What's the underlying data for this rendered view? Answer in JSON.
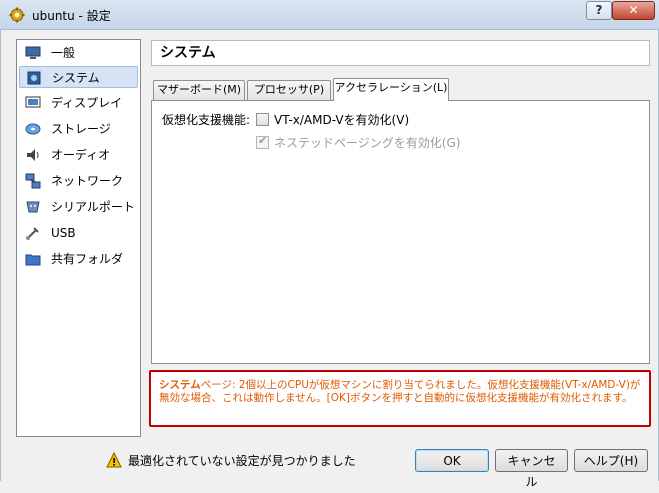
{
  "window": {
    "title": "ubuntu - 設定",
    "help_button": "?",
    "close_button": "✕"
  },
  "sidebar": {
    "items": [
      {
        "label": "一般",
        "icon": "monitor-icon"
      },
      {
        "label": "システム",
        "icon": "chip-icon"
      },
      {
        "label": "ディスプレイ",
        "icon": "display-icon"
      },
      {
        "label": "ストレージ",
        "icon": "disk-icon"
      },
      {
        "label": "オーディオ",
        "icon": "speaker-icon"
      },
      {
        "label": "ネットワーク",
        "icon": "network-icon"
      },
      {
        "label": "シリアルポート",
        "icon": "serial-port-icon"
      },
      {
        "label": "USB",
        "icon": "usb-icon"
      },
      {
        "label": "共有フォルダ",
        "icon": "folder-icon"
      }
    ],
    "selected": "システム"
  },
  "page": {
    "title": "システム",
    "tabs": [
      {
        "label": "マザーボード(M)"
      },
      {
        "label": "プロセッサ(P)"
      },
      {
        "label": "アクセラレーション(L)"
      }
    ],
    "active_tab": "アクセラレーション(L)",
    "virtualization": {
      "label": "仮想化支援機能:",
      "vtx_label": "VT-x/AMD-Vを有効化(V)",
      "vtx_checked": false,
      "nested_paging_label": "ネステッドページングを有効化(G)",
      "nested_paging_checked": true,
      "nested_paging_enabled": false
    }
  },
  "warning": {
    "page_name": "システム",
    "message": "ページ: 2個以上のCPUが仮想マシンに割り当てられました。仮想化支援機能(VT-x/AMD-V)が無効な場合、これは動作しません。[OK]ボタンを押すと自動的に仮想化支援機能が有効化されます。",
    "color": "#e05a00",
    "border_color": "#c00000"
  },
  "footer": {
    "status": "最適化されていない設定が見つかりました",
    "ok_label": "OK",
    "cancel_label": "キャンセル",
    "help_label": "ヘルプ(H)"
  }
}
